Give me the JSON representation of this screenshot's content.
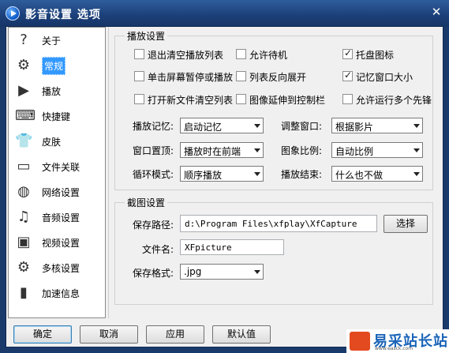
{
  "window": {
    "title": "影音设置 选项",
    "close_glyph": "✕"
  },
  "sidebar": {
    "items": [
      {
        "label": "关于",
        "icon": "?",
        "icon_name": "about-icon"
      },
      {
        "label": "常规",
        "icon": "⚙",
        "icon_name": "gear-icon"
      },
      {
        "label": "播放",
        "icon": "▶",
        "icon_name": "play-icon"
      },
      {
        "label": "快捷键",
        "icon": "⌨",
        "icon_name": "keyboard-icon"
      },
      {
        "label": "皮肤",
        "icon": "👕",
        "icon_name": "shirt-icon"
      },
      {
        "label": "文件关联",
        "icon": "▭",
        "icon_name": "folder-icon"
      },
      {
        "label": "网络设置",
        "icon": "◍",
        "icon_name": "globe-icon"
      },
      {
        "label": "音频设置",
        "icon": "♫",
        "icon_name": "audio-icon"
      },
      {
        "label": "视频设置",
        "icon": "▣",
        "icon_name": "tv-icon"
      },
      {
        "label": "多核设置",
        "icon": "⚙",
        "icon_name": "multicore-icon"
      },
      {
        "label": "加速信息",
        "icon": "▮",
        "icon_name": "acceleration-icon"
      }
    ],
    "active_index": 1
  },
  "playback": {
    "title": "播放设置",
    "checkboxes": [
      {
        "label": "退出清空播放列表",
        "checked": false
      },
      {
        "label": "允许待机",
        "checked": false
      },
      {
        "label": "托盘图标",
        "checked": true
      },
      {
        "label": "单击屏幕暂停或播放",
        "checked": false
      },
      {
        "label": "列表反向展开",
        "checked": false
      },
      {
        "label": "记忆窗口大小",
        "checked": true
      },
      {
        "label": "打开新文件清空列表",
        "checked": false
      },
      {
        "label": "图像延伸到控制栏",
        "checked": false
      },
      {
        "label": "允许运行多个先锋",
        "checked": false
      }
    ],
    "selects": [
      {
        "label": "播放记忆:",
        "value": "启动记忆"
      },
      {
        "label": "调整窗口:",
        "value": "根据影片"
      },
      {
        "label": "窗口置顶:",
        "value": "播放时在前端"
      },
      {
        "label": "图象比例:",
        "value": "自动比例"
      },
      {
        "label": "循环模式:",
        "value": "顺序播放"
      },
      {
        "label": "播放结束:",
        "value": "什么也不做"
      }
    ]
  },
  "capture": {
    "title": "截图设置",
    "path_label": "保存路径:",
    "path_value": "d:\\Program Files\\xfplay\\XfCapture",
    "browse_label": "选择",
    "filename_label": "文件名:",
    "filename_value": "XFpicture",
    "format_label": "保存格式:",
    "format_value": ".jpg"
  },
  "footer": {
    "ok": "确定",
    "cancel": "取消",
    "apply": "应用",
    "default": "默认值"
  },
  "watermark": {
    "text": "易采站长站",
    "sub": "www.easck.com"
  }
}
